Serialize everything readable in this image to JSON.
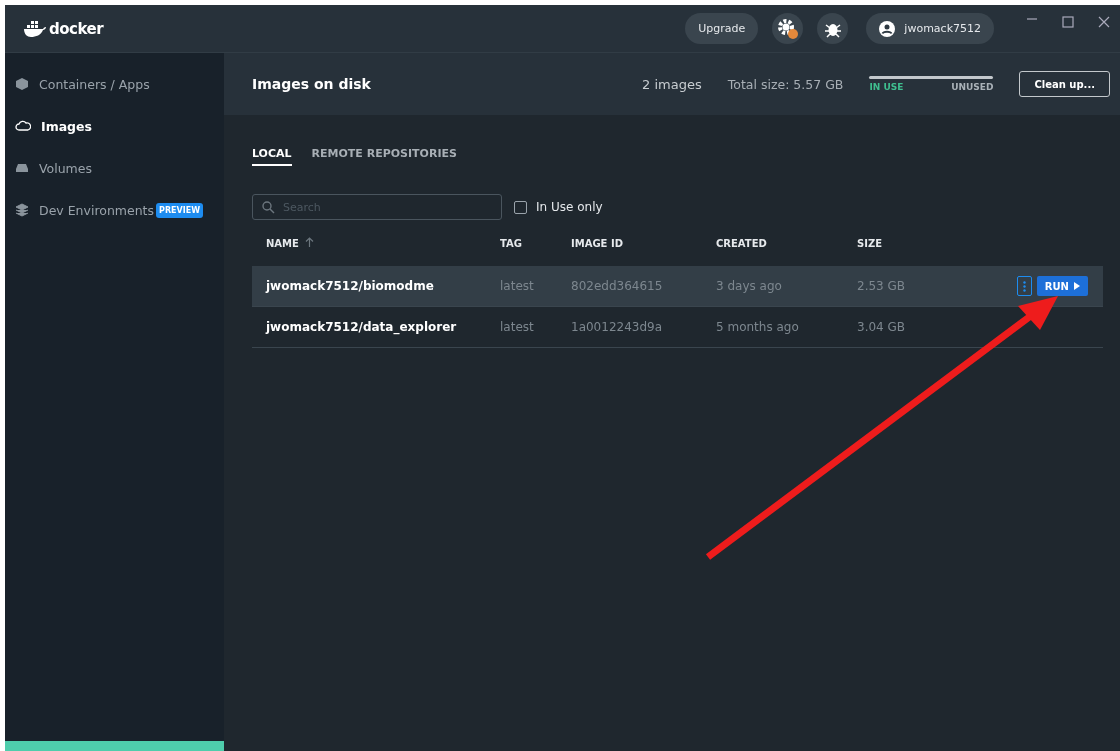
{
  "app": {
    "logo_text": "docker"
  },
  "topbar": {
    "upgrade": "Upgrade",
    "username": "jwomack7512"
  },
  "sidebar": {
    "items": [
      {
        "label": "Containers / Apps",
        "selected": false
      },
      {
        "label": "Images",
        "selected": true
      },
      {
        "label": "Volumes",
        "selected": false
      },
      {
        "label": "Dev Environments",
        "selected": false,
        "badge": "PREVIEW"
      }
    ]
  },
  "header": {
    "title": "Images on disk",
    "count": "2 images",
    "total": "Total size: 5.57 GB",
    "in_use": "IN USE",
    "unused": "UNUSED",
    "cleanup": "Clean up..."
  },
  "tabs": [
    {
      "label": "LOCAL",
      "selected": true
    },
    {
      "label": "REMOTE REPOSITORIES",
      "selected": false
    }
  ],
  "search": {
    "placeholder": "Search"
  },
  "in_use_only": {
    "label": "In Use only",
    "checked": false
  },
  "table": {
    "columns": [
      "NAME",
      "TAG",
      "IMAGE ID",
      "CREATED",
      "SIZE"
    ],
    "run_label": "RUN",
    "rows": [
      {
        "name": "jwomack7512/biomodme",
        "tag": "latest",
        "image_id": "802edd364615",
        "created": "3 days ago",
        "size": "2.53 GB",
        "selected": true
      },
      {
        "name": "jwomack7512/data_explorer",
        "tag": "latest",
        "image_id": "1a0012243d9a",
        "created": "5 months ago",
        "size": "3.04 GB",
        "selected": false
      }
    ]
  }
}
